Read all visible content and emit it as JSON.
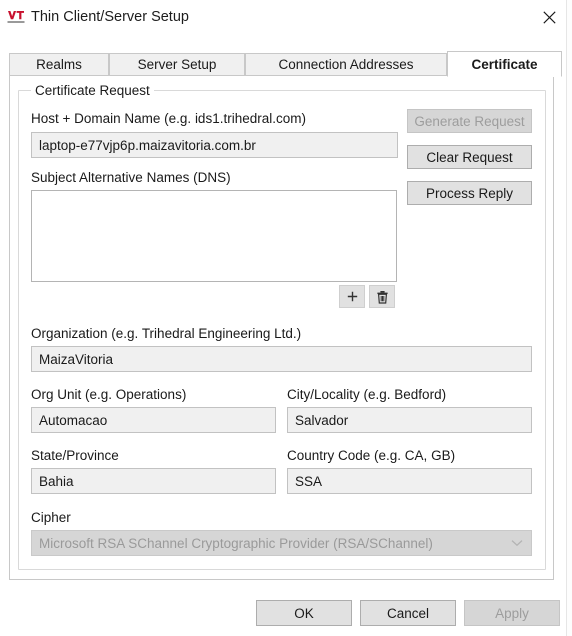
{
  "window": {
    "title": "Thin Client/Server Setup",
    "icon": "vt-logo-icon",
    "close_label": "✕"
  },
  "tabs": [
    {
      "label": "Realms",
      "active": false
    },
    {
      "label": "Server Setup",
      "active": false
    },
    {
      "label": "Connection Addresses",
      "active": false
    },
    {
      "label": "Certificate",
      "active": true
    }
  ],
  "certificate": {
    "group_title": "Certificate Request",
    "host_domain": {
      "label": "Host + Domain Name (e.g. ids1.trihedral.com)",
      "value": "laptop-e77vjp6p.maizavitoria.com.br"
    },
    "san": {
      "label": "Subject Alternative Names (DNS)",
      "value": "",
      "add_label": "+",
      "delete_label": "delete"
    },
    "organization": {
      "label": "Organization (e.g. Trihedral Engineering Ltd.)",
      "value": "MaizaVitoria"
    },
    "org_unit": {
      "label": "Org Unit (e.g. Operations)",
      "value": "Automacao"
    },
    "city": {
      "label": "City/Locality (e.g. Bedford)",
      "value": "Salvador"
    },
    "state": {
      "label": "State/Province",
      "value": "Bahia"
    },
    "country": {
      "label": "Country Code (e.g. CA, GB)",
      "value": "SSA"
    },
    "cipher": {
      "label": "Cipher",
      "value": "Microsoft RSA SChannel Cryptographic Provider (RSA/SChannel)",
      "disabled": true
    },
    "actions": {
      "generate": "Generate Request",
      "clear": "Clear Request",
      "process": "Process Reply"
    }
  },
  "dialog_buttons": {
    "ok": "OK",
    "cancel": "Cancel",
    "apply": "Apply"
  },
  "colors": {
    "accent_logo": "#c8102e",
    "panel_border": "#c8c8c8",
    "field_bg": "#f0f0f0",
    "button_bg": "#e1e1e1",
    "disabled_text": "#9d9d9d"
  }
}
